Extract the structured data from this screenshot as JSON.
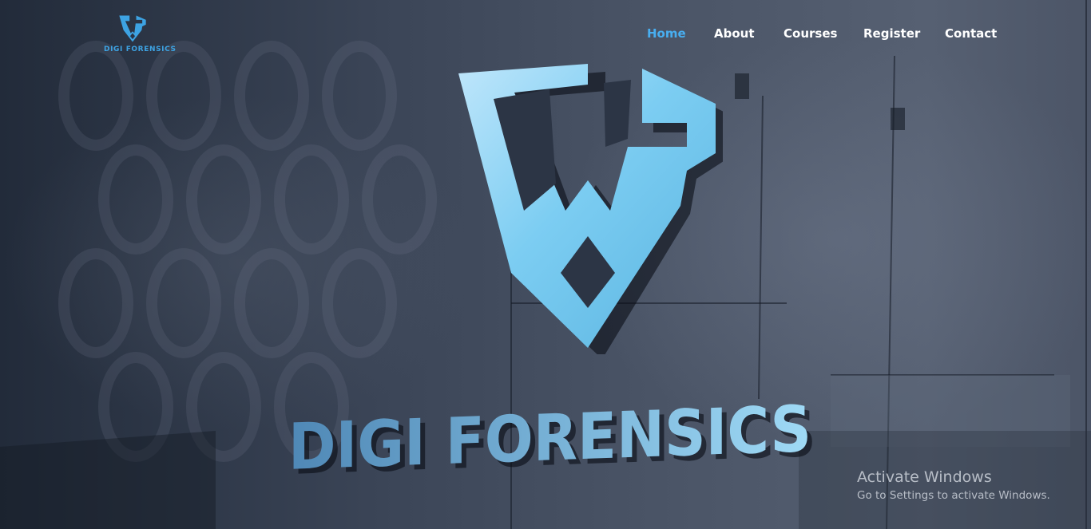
{
  "brand": {
    "logo_icon": "df-shield-logo-icon",
    "name": "DIGI FORENSICS"
  },
  "nav": {
    "items": [
      {
        "label": "Home",
        "active": true
      },
      {
        "label": "About",
        "active": false
      },
      {
        "label": "Courses",
        "active": false
      },
      {
        "label": "Register",
        "active": false
      },
      {
        "label": "Contact",
        "active": false
      }
    ]
  },
  "hero": {
    "emblem_icon": "df-shield-emblem",
    "wordmark": "DIGI FORENSICS"
  },
  "watermark": {
    "title": "Activate Windows",
    "subtitle": "Go to Settings to activate Windows."
  },
  "colors": {
    "accent": "#48aef0",
    "nav_text": "#ffffff",
    "background": "#2b3444",
    "logo": "#3da3e3"
  }
}
